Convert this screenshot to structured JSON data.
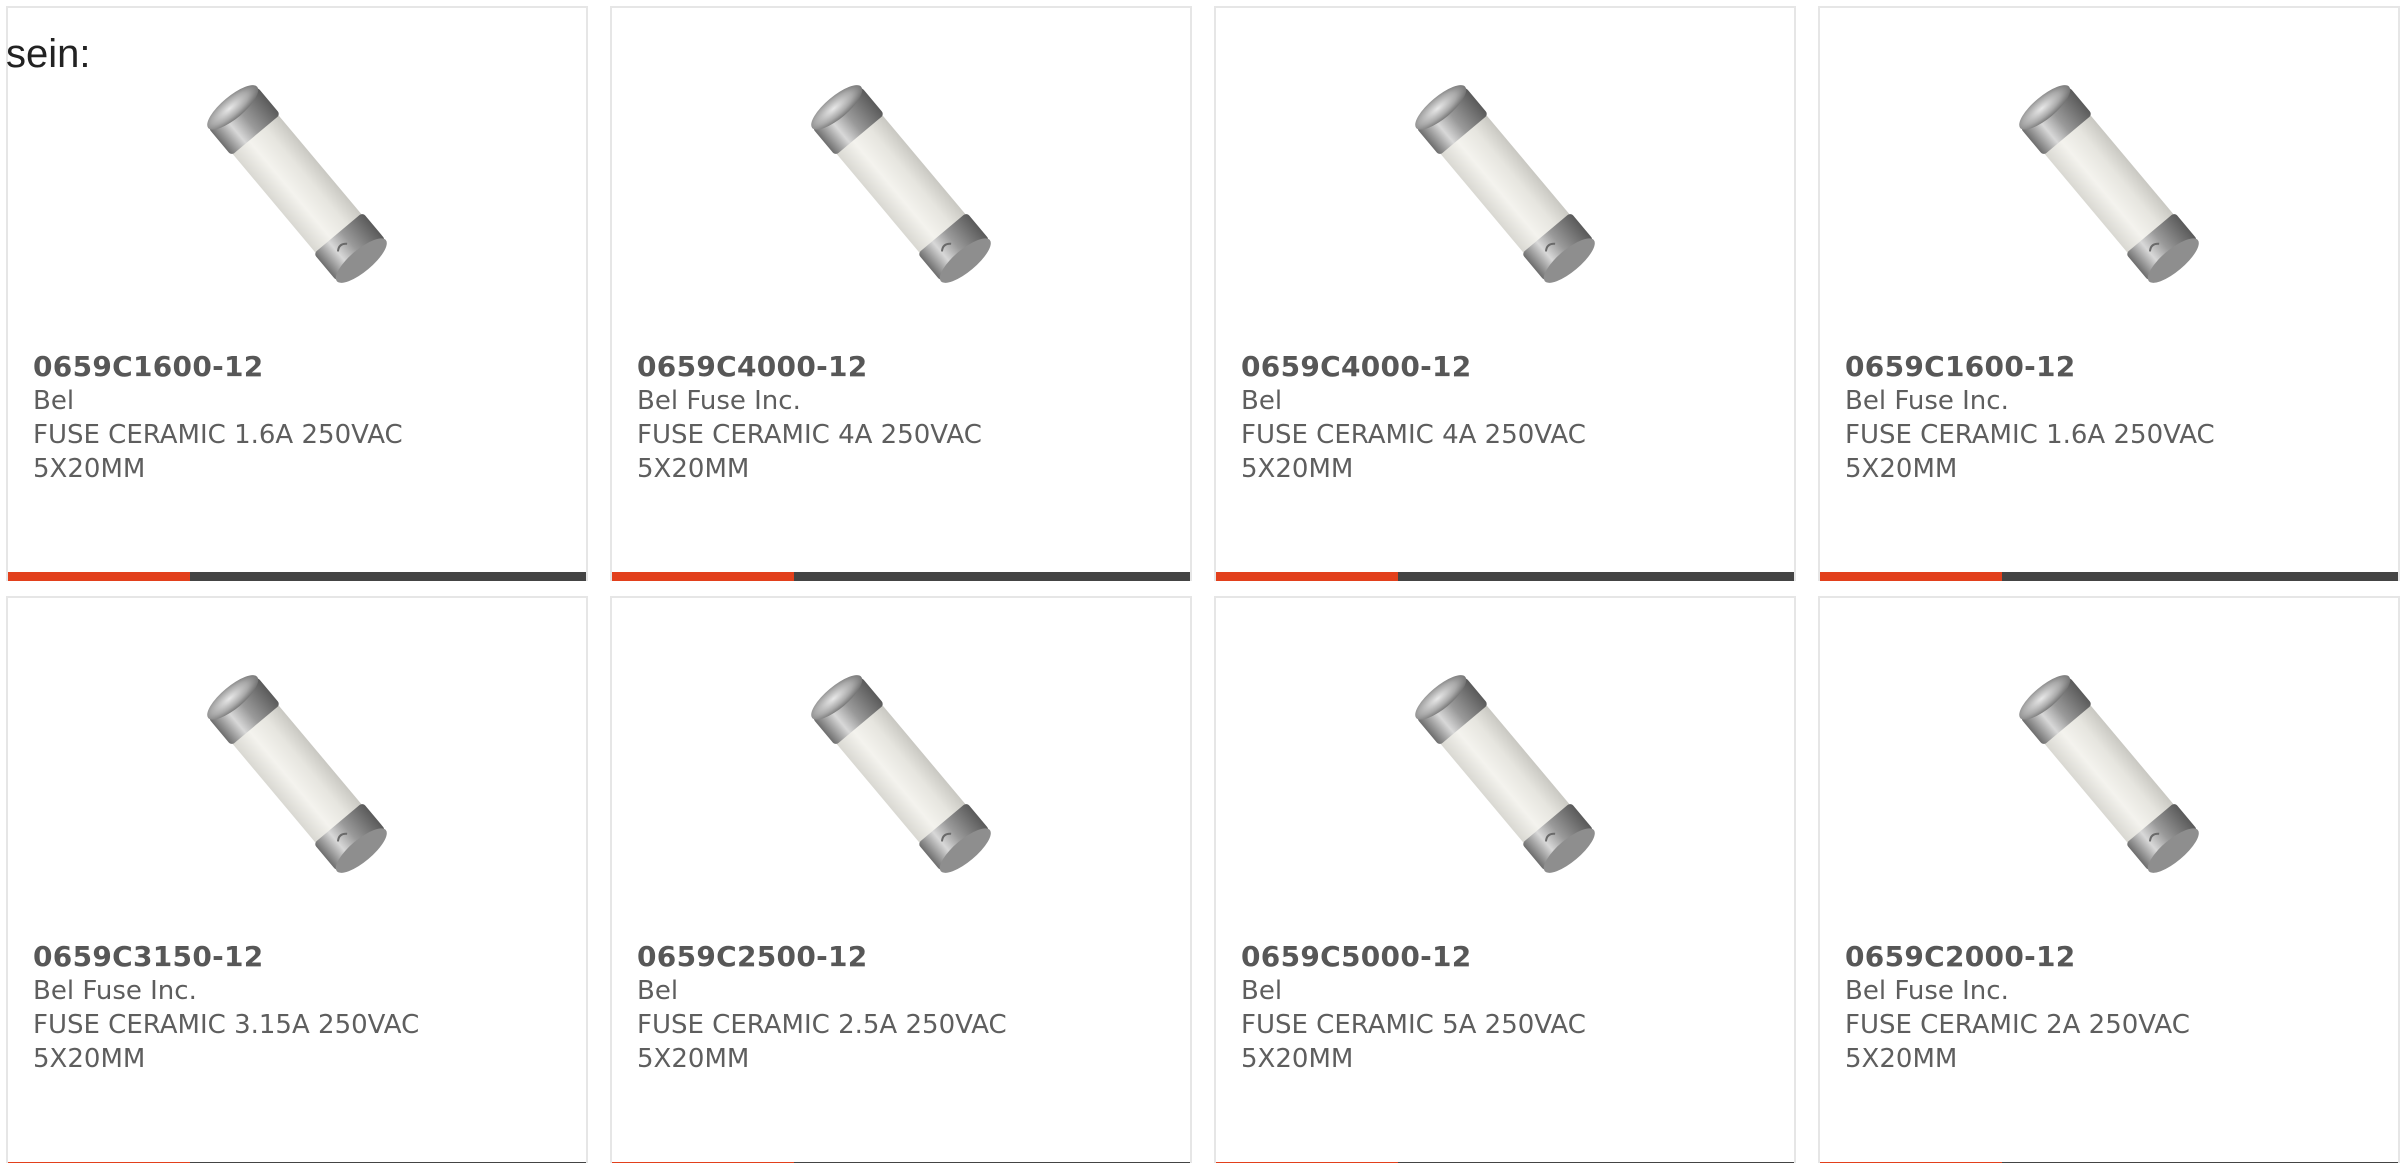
{
  "intro_text": "sein:",
  "colors": {
    "accent": "#e2401c",
    "bar": "#444444",
    "card_border": "#e6e6e6",
    "text": "#5e5e5e"
  },
  "products": [
    {
      "part_number": "0659C1600-12",
      "manufacturer": "Bel",
      "description": "FUSE CERAMIC 1.6A 250VAC 5X20MM",
      "image_icon": "ceramic-fuse-icon"
    },
    {
      "part_number": "0659C4000-12",
      "manufacturer": "Bel Fuse Inc.",
      "description": "FUSE CERAMIC 4A 250VAC 5X20MM",
      "image_icon": "ceramic-fuse-icon"
    },
    {
      "part_number": "0659C4000-12",
      "manufacturer": "Bel",
      "description": "FUSE CERAMIC 4A 250VAC 5X20MM",
      "image_icon": "ceramic-fuse-icon"
    },
    {
      "part_number": "0659C1600-12",
      "manufacturer": "Bel Fuse Inc.",
      "description": "FUSE CERAMIC 1.6A 250VAC 5X20MM",
      "image_icon": "ceramic-fuse-icon"
    },
    {
      "part_number": "0659C3150-12",
      "manufacturer": "Bel Fuse Inc.",
      "description": "FUSE CERAMIC 3.15A 250VAC 5X20MM",
      "image_icon": "ceramic-fuse-icon"
    },
    {
      "part_number": "0659C2500-12",
      "manufacturer": "Bel",
      "description": "FUSE CERAMIC 2.5A 250VAC 5X20MM",
      "image_icon": "ceramic-fuse-icon"
    },
    {
      "part_number": "0659C5000-12",
      "manufacturer": "Bel",
      "description": "FUSE CERAMIC 5A 250VAC 5X20MM",
      "image_icon": "ceramic-fuse-icon"
    },
    {
      "part_number": "0659C2000-12",
      "manufacturer": "Bel Fuse Inc.",
      "description": "FUSE CERAMIC 2A 250VAC 5X20MM",
      "image_icon": "ceramic-fuse-icon"
    }
  ]
}
